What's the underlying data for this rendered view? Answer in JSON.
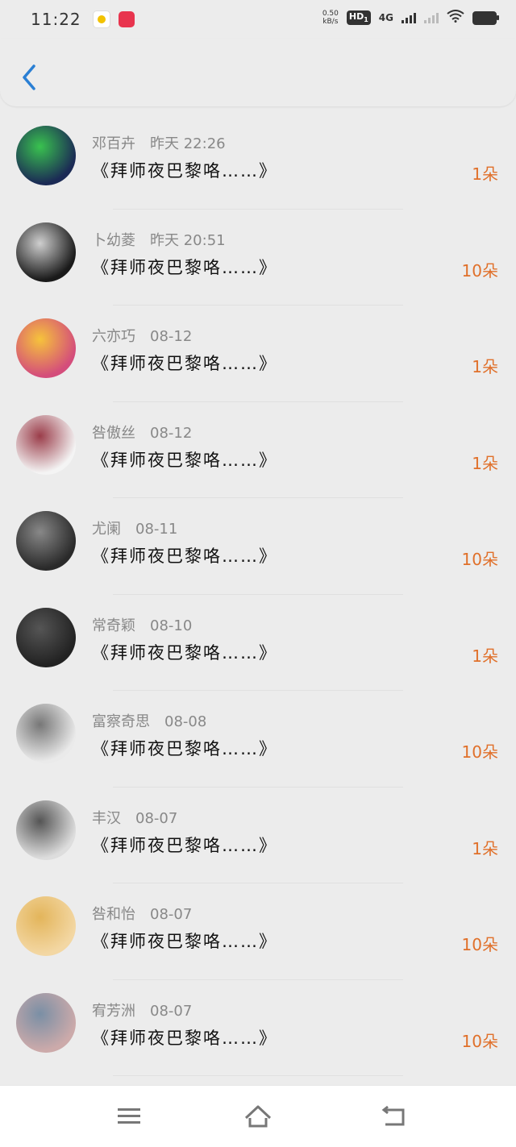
{
  "status": {
    "time": "11:22",
    "net_speed_value": "0.50",
    "net_speed_unit": "kB/s",
    "hd_label": "HD",
    "hd_sub": "1",
    "network": "4G"
  },
  "header": {
    "back_icon": "chevron-left-icon"
  },
  "colors": {
    "accent": "#e0702a",
    "back": "#2a7fd4"
  },
  "rows": [
    {
      "name": "邓百卉",
      "date": "昨天 22:26",
      "title": "《拜师夜巴黎咯……》",
      "count": "1朵"
    },
    {
      "name": "卜幼菱",
      "date": "昨天 20:51",
      "title": "《拜师夜巴黎咯……》",
      "count": "10朵"
    },
    {
      "name": "六亦巧",
      "date": "08-12",
      "title": "《拜师夜巴黎咯……》",
      "count": "1朵"
    },
    {
      "name": "咎傲丝",
      "date": "08-12",
      "title": "《拜师夜巴黎咯……》",
      "count": "1朵"
    },
    {
      "name": "尤阑",
      "date": "08-11",
      "title": "《拜师夜巴黎咯……》",
      "count": "10朵"
    },
    {
      "name": "常奇颖",
      "date": "08-10",
      "title": "《拜师夜巴黎咯……》",
      "count": "1朵"
    },
    {
      "name": "富察奇思",
      "date": "08-08",
      "title": "《拜师夜巴黎咯……》",
      "count": "10朵"
    },
    {
      "name": "丰汉",
      "date": "08-07",
      "title": "《拜师夜巴黎咯……》",
      "count": "1朵"
    },
    {
      "name": "咎和怡",
      "date": "08-07",
      "title": "《拜师夜巴黎咯……》",
      "count": "10朵"
    },
    {
      "name": "宥芳洲",
      "date": "08-07",
      "title": "《拜师夜巴黎咯……》",
      "count": "10朵"
    }
  ],
  "navbar": {
    "menu_icon": "menu-icon",
    "home_icon": "home-icon",
    "back_icon": "return-icon"
  }
}
